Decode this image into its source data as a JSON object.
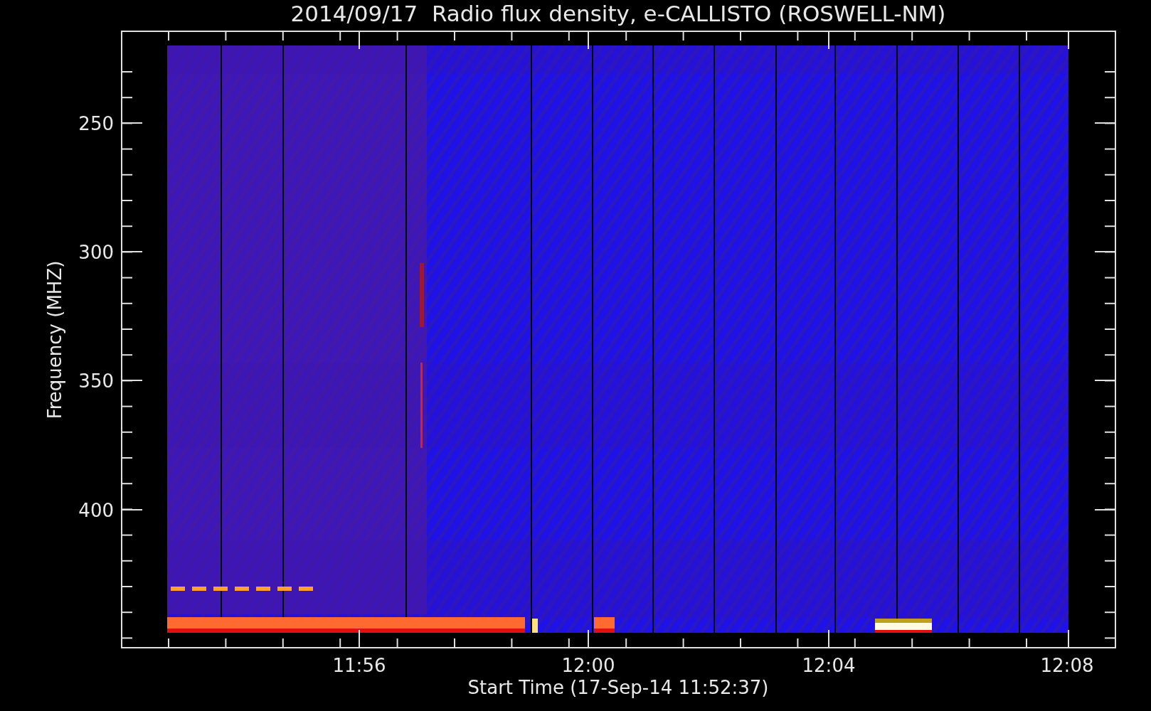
{
  "title": "2014/09/17  Radio flux density, e-CALLISTO (ROSWELL-NM)",
  "y_axis": {
    "label": "Frequency (MHZ)",
    "ticks": [
      "250",
      "300",
      "350",
      "400"
    ]
  },
  "x_axis": {
    "label": "Start Time (17-Sep-14 11:52:37)",
    "ticks": [
      "11:56",
      "12:00",
      "12:04",
      "12:08"
    ]
  }
}
